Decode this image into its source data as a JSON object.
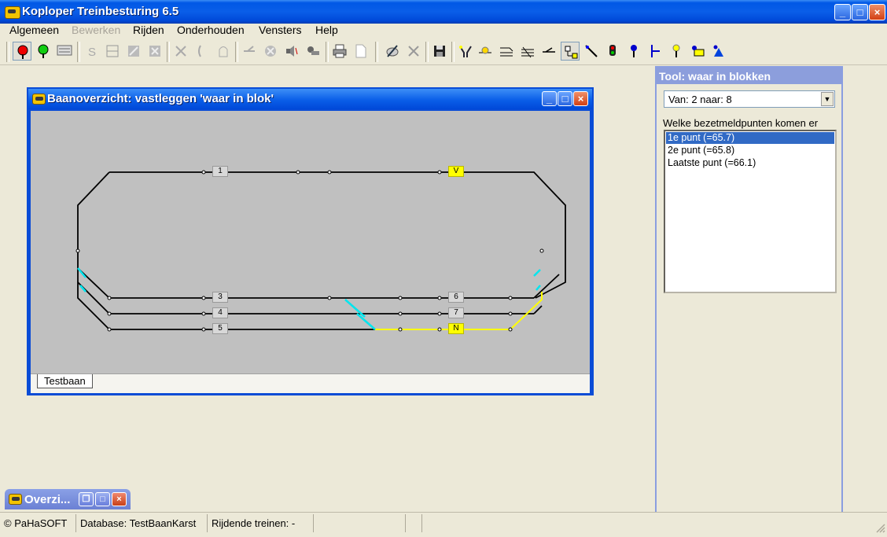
{
  "app": {
    "title": "Koploper Treinbesturing 6.5",
    "window_buttons": [
      "_",
      "□",
      "×"
    ]
  },
  "menu": {
    "items": [
      {
        "label": "Algemeen",
        "enabled": true
      },
      {
        "label": "Bewerken",
        "enabled": false
      },
      {
        "label": "Rijden",
        "enabled": true
      },
      {
        "label": "Onderhouden",
        "enabled": true
      },
      {
        "label": "Vensters",
        "enabled": true
      },
      {
        "label": "Help",
        "enabled": true
      }
    ]
  },
  "toolbar": {
    "icons": [
      "signal-red-icon",
      "signal-green-icon",
      "train-list-icon",
      "s-text-icon",
      "block-icon",
      "edit-block-icon",
      "delete-block-icon",
      "loc-off-icon",
      "stop-icon",
      "ghost-icon",
      "switch-icon",
      "stop-circle-icon",
      "sound-icon",
      "locomotive-icon",
      "print-icon",
      "new-page-icon",
      "draw-pen-icon",
      "cancel-icon",
      "save-icon",
      "route-icon",
      "light-icon",
      "signal-arm-icon",
      "crossing-icon",
      "track-edit-icon",
      "block-edit-icon",
      "line-icon",
      "signal-icon",
      "pin-icon",
      "turnout-icon",
      "lamp-icon",
      "sensor-icon",
      "marker-icon"
    ]
  },
  "track_window": {
    "title": "Baanoverzicht: vastleggen 'waar in blok'",
    "tab": "Testbaan",
    "blocks": [
      {
        "label": "1",
        "state": "normal"
      },
      {
        "label": "V",
        "state": "highlight"
      },
      {
        "label": "3",
        "state": "normal"
      },
      {
        "label": "6",
        "state": "normal"
      },
      {
        "label": "4",
        "state": "normal"
      },
      {
        "label": "7",
        "state": "normal"
      },
      {
        "label": "5",
        "state": "normal"
      },
      {
        "label": "N",
        "state": "highlight"
      }
    ],
    "colors": {
      "track": "#000000",
      "route": "#ffff00",
      "switch": "#00e5ee",
      "background": "#c0c0c0"
    }
  },
  "tool_panel": {
    "title": "Tool: waar in blokken",
    "selection": "Van: 2 naar: 8",
    "question": "Welke bezetmeldpunten komen er",
    "points": [
      {
        "label": "1e punt (=65.7)",
        "selected": true
      },
      {
        "label": "2e punt (=65.8)",
        "selected": false
      },
      {
        "label": "Laatste punt (=66.1)",
        "selected": false
      }
    ]
  },
  "minimized_window": {
    "title": "Overzi..."
  },
  "status": {
    "copyright": "© PaHaSOFT",
    "database": "Database: TestBaanKarst",
    "trains": "Rijdende treinen: -"
  }
}
